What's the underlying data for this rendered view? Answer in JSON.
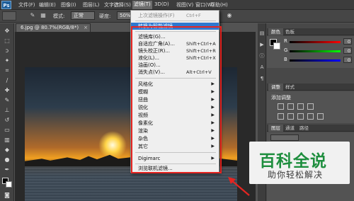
{
  "app": {
    "logo": "Ps"
  },
  "menubar": {
    "items": [
      "文件(F)",
      "编辑(E)",
      "图像(I)",
      "图层(L)",
      "文字(Y)",
      "选择(S)",
      "滤镜(T)",
      "3D(D)",
      "视图(V)",
      "窗口(W)",
      "帮助(H)"
    ],
    "active_index": 6
  },
  "options_bar": {
    "mode_label": "模式:",
    "mode_value": "正常",
    "opacity_label": "硬度:",
    "opacity_value": "50%"
  },
  "document": {
    "tab_title": "6.jpg @ 80.7%(RGB/8*)",
    "close_glyph": "×"
  },
  "filter_menu": {
    "last_filter": {
      "label": "上次滤镜操作(F)",
      "shortcut": "Ctrl+F"
    },
    "convert_smart": "转换为智能滤镜",
    "items_a": [
      {
        "label": "滤镜库(G)...",
        "shortcut": ""
      },
      {
        "label": "自适应广角(A)...",
        "shortcut": "Shift+Ctrl+A"
      },
      {
        "label": "镜头校正(R)...",
        "shortcut": "Shift+Ctrl+R"
      },
      {
        "label": "液化(L)...",
        "shortcut": "Shift+Ctrl+X"
      },
      {
        "label": "油画(O)...",
        "shortcut": ""
      },
      {
        "label": "消失点(V)...",
        "shortcut": "Alt+Ctrl+V"
      }
    ],
    "items_b": [
      "风格化",
      "模糊",
      "扭曲",
      "锐化",
      "视频",
      "像素化",
      "渲染",
      "杂色",
      "其它"
    ],
    "digimarc": "Digimarc",
    "browse_online": "浏览联机滤镜..."
  },
  "panels": {
    "color_tabs": [
      "颜色",
      "色板"
    ],
    "color_values": {
      "r": 0,
      "g": 0,
      "b": 0
    },
    "color_labels": {
      "r": "R",
      "g": "G",
      "b": "B"
    },
    "adjust_tabs": [
      "调整",
      "样式"
    ],
    "adjust_title": "添加调整",
    "layer_tabs": [
      "图层",
      "通道",
      "路径"
    ]
  },
  "watermark": {
    "title": "百科全说",
    "subtitle": "助你轻松解决"
  },
  "colors": {
    "highlight": "#2f78d0",
    "annotation_red": "#e52521",
    "watermark_green": "#1e8e3e"
  }
}
